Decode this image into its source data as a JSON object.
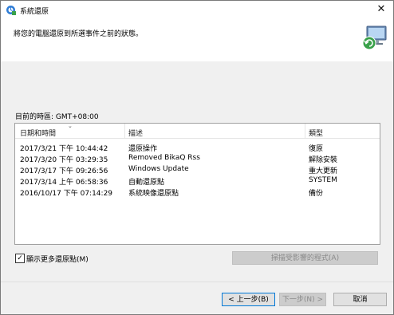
{
  "window": {
    "title": "系統還原",
    "close_glyph": "✕"
  },
  "header": {
    "instruction": "將您的電腦還原到所選事件之前的狀態。"
  },
  "timezone": {
    "label": "目前的時區: GMT+08:00"
  },
  "restore_list": {
    "columns": [
      "日期和時間",
      "描述",
      "類型"
    ],
    "rows": [
      [
        "2017/3/21 下午 10:44:42",
        "還原操作",
        "復原"
      ],
      [
        "2017/3/20 下午 03:29:35",
        "Removed BikaQ Rss",
        "解除安裝"
      ],
      [
        "2017/3/17 下午 09:26:56",
        "Windows Update",
        "重大更新"
      ],
      [
        "2017/3/14 上午 06:58:36",
        "自動還原點",
        "SYSTEM"
      ],
      [
        "2016/10/17 下午 07:14:29",
        "系統映像還原點",
        "備份"
      ]
    ]
  },
  "options": {
    "show_more_label": "顯示更多還原點(M)",
    "show_more_checked": true,
    "checked_glyph": "✓",
    "scan_button_label": "掃描受影響的程式(A)",
    "scan_button_enabled": false
  },
  "footer": {
    "back_label": "< 上一步(B)",
    "next_label": "下一步(N) >",
    "next_enabled": false,
    "cancel_label": "取消"
  },
  "icons": {
    "app": "system-restore-icon",
    "header": "computer-restore-icon",
    "sort": "sort-down-icon"
  },
  "colors": {
    "dialog_bg": "#f0f0f0",
    "header_bg": "#ffffff",
    "default_button_border": "#0078d7"
  }
}
